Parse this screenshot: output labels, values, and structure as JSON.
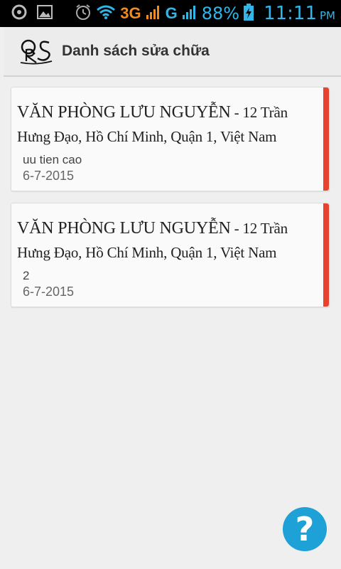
{
  "status_bar": {
    "network_3g": "3G",
    "network_g": "G",
    "battery": "88%",
    "time": "11:11",
    "ampm": "PM",
    "icons": [
      "settings-icon",
      "image-icon",
      "alarm-icon",
      "wifi-icon",
      "signal-icon",
      "signal-icon",
      "battery-charging-icon"
    ]
  },
  "app_bar": {
    "title": "Danh sách sửa chữa",
    "logo_icon": "qrs-logo"
  },
  "cards": [
    {
      "name": "VĂN PHÒNG LƯU NGUYỄN",
      "address": " - 12 Trần Hưng Đạo, Hồ Chí Minh, Quận 1, Việt Nam",
      "note": "uu tien cao",
      "date": "6-7-2015",
      "accent_color": "#e8432e"
    },
    {
      "name": "VĂN PHÒNG LƯU NGUYỄN",
      "address": " - 12 Trần Hưng Đạo, Hồ Chí Minh, Quận 1, Việt Nam",
      "note": "2",
      "date": "6-7-2015",
      "accent_color": "#e8432e"
    }
  ],
  "help_button": {
    "label": "?",
    "color": "#1da1d6"
  }
}
